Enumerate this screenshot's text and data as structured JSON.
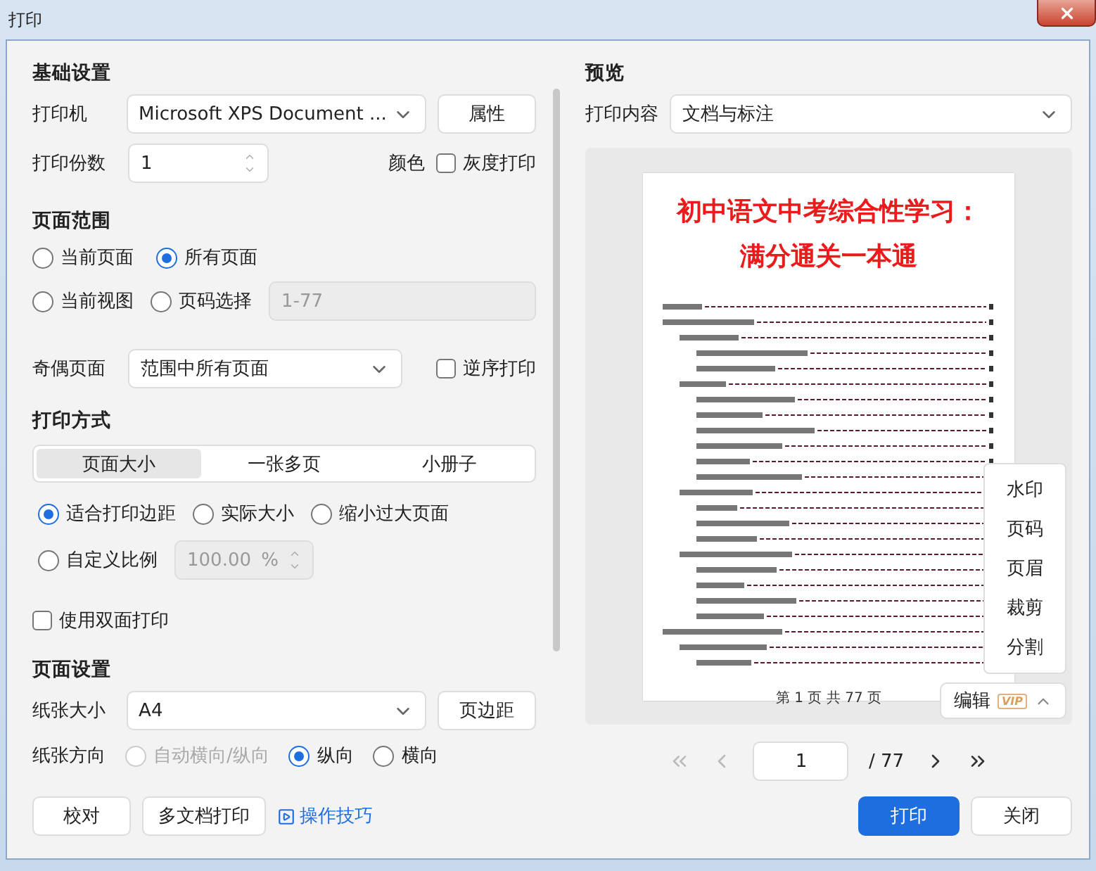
{
  "window": {
    "title": "打印"
  },
  "basic": {
    "heading": "基础设置",
    "printer": {
      "label": "打印机",
      "value": "Microsoft XPS Document ..."
    },
    "properties_button": "属性",
    "copies": {
      "label": "打印份数",
      "value": "1"
    },
    "color_label": "颜色",
    "grayscale": {
      "label": "灰度打印",
      "checked": false
    }
  },
  "page_range": {
    "heading": "页面范围",
    "options": [
      {
        "label": "当前页面",
        "selected": false
      },
      {
        "label": "所有页面",
        "selected": true
      },
      {
        "label": "当前视图",
        "selected": false
      },
      {
        "label": "页码选择",
        "selected": false
      }
    ],
    "pages_field": {
      "value": "1-77",
      "disabled": true
    }
  },
  "odd_even": {
    "label": "奇偶页面",
    "value": "范围中所有页面",
    "reverse": {
      "label": "逆序打印",
      "checked": false
    }
  },
  "print_mode": {
    "heading": "打印方式",
    "tabs": [
      {
        "label": "页面大小",
        "selected": true
      },
      {
        "label": "一张多页",
        "selected": false
      },
      {
        "label": "小册子",
        "selected": false
      }
    ],
    "scaling": [
      {
        "label": "适合打印边距",
        "selected": true
      },
      {
        "label": "实际大小",
        "selected": false
      },
      {
        "label": "缩小过大页面",
        "selected": false
      },
      {
        "label": "自定义比例",
        "selected": false
      }
    ],
    "ratio": {
      "value": "100.00",
      "unit": "%",
      "disabled": true
    },
    "duplex": {
      "label": "使用双面打印",
      "checked": false
    }
  },
  "page_setup": {
    "heading": "页面设置",
    "paper_size": {
      "label": "纸张大小",
      "value": "A4"
    },
    "margins_button": "页边距",
    "orientation": {
      "label": "纸张方向",
      "options": [
        {
          "label": "自动横向/纵向",
          "selected": false,
          "disabled": true
        },
        {
          "label": "纵向",
          "selected": true,
          "disabled": false
        },
        {
          "label": "横向",
          "selected": false,
          "disabled": false
        }
      ]
    }
  },
  "footer_left": {
    "buttons": [
      "校对",
      "多文档打印"
    ],
    "tips_link": "操作技巧"
  },
  "preview": {
    "heading": "预览",
    "content": {
      "label": "打印内容",
      "value": "文档与标注"
    },
    "page": {
      "title_lines": [
        "初中语文中考综合性学习：",
        "满分通关一本通"
      ],
      "footer": "第 1 页 共 77 页"
    },
    "edit_menu": {
      "items": [
        "水印",
        "页码",
        "页眉",
        "裁剪",
        "分割"
      ],
      "button": "编辑",
      "badge": "VIP",
      "expanded": true
    },
    "pager": {
      "nav": [
        {
          "kind": "first",
          "disabled": true
        },
        {
          "kind": "prev",
          "disabled": true
        },
        {
          "kind": "next",
          "disabled": false
        },
        {
          "kind": "last",
          "disabled": false
        }
      ],
      "current": "1",
      "total": "/ 77"
    }
  },
  "buttons": [
    {
      "label": "打印",
      "kind": "primary"
    },
    {
      "label": "关闭",
      "kind": "secondary"
    }
  ]
}
